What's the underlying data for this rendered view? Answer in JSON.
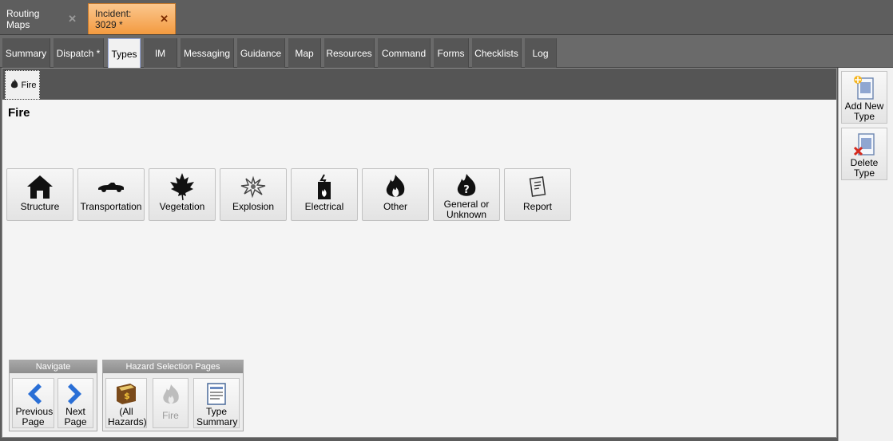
{
  "doc_tabs": [
    {
      "label": "Routing Maps"
    },
    {
      "label": "Incident: 3029 *"
    }
  ],
  "nav_tabs": [
    {
      "label": "Summary"
    },
    {
      "label": "Dispatch *"
    },
    {
      "label": "Types"
    },
    {
      "label": "IM"
    },
    {
      "label": "Messaging"
    },
    {
      "label": "Guidance"
    },
    {
      "label": "Map"
    },
    {
      "label": "Resources"
    },
    {
      "label": "Command"
    },
    {
      "label": "Forms"
    },
    {
      "label": "Checklists"
    },
    {
      "label": "Log"
    }
  ],
  "sub_tab": {
    "label": "Fire",
    "icon": "flame-icon"
  },
  "section_title": "Fire",
  "type_buttons": [
    {
      "label": "Structure",
      "icon": "house-icon"
    },
    {
      "label": "Transportation",
      "icon": "car-icon"
    },
    {
      "label": "Vegetation",
      "icon": "maple-leaf-icon"
    },
    {
      "label": "Explosion",
      "icon": "explosion-icon"
    },
    {
      "label": "Electrical",
      "icon": "electrical-fire-icon"
    },
    {
      "label": "Other",
      "icon": "flame-icon"
    },
    {
      "label": "General or Unknown",
      "icon": "unknown-fire-icon"
    },
    {
      "label": "Report",
      "icon": "report-icon"
    }
  ],
  "navigate_group": {
    "title": "Navigate",
    "previous": "Previous Page",
    "next": "Next Page"
  },
  "hazard_group": {
    "title": "Hazard Selection Pages",
    "all": "(All Hazards)",
    "fire": "Fire",
    "summary": "Type Summary"
  },
  "side_panel": {
    "add": "Add New Type",
    "delete": "Delete Type"
  }
}
